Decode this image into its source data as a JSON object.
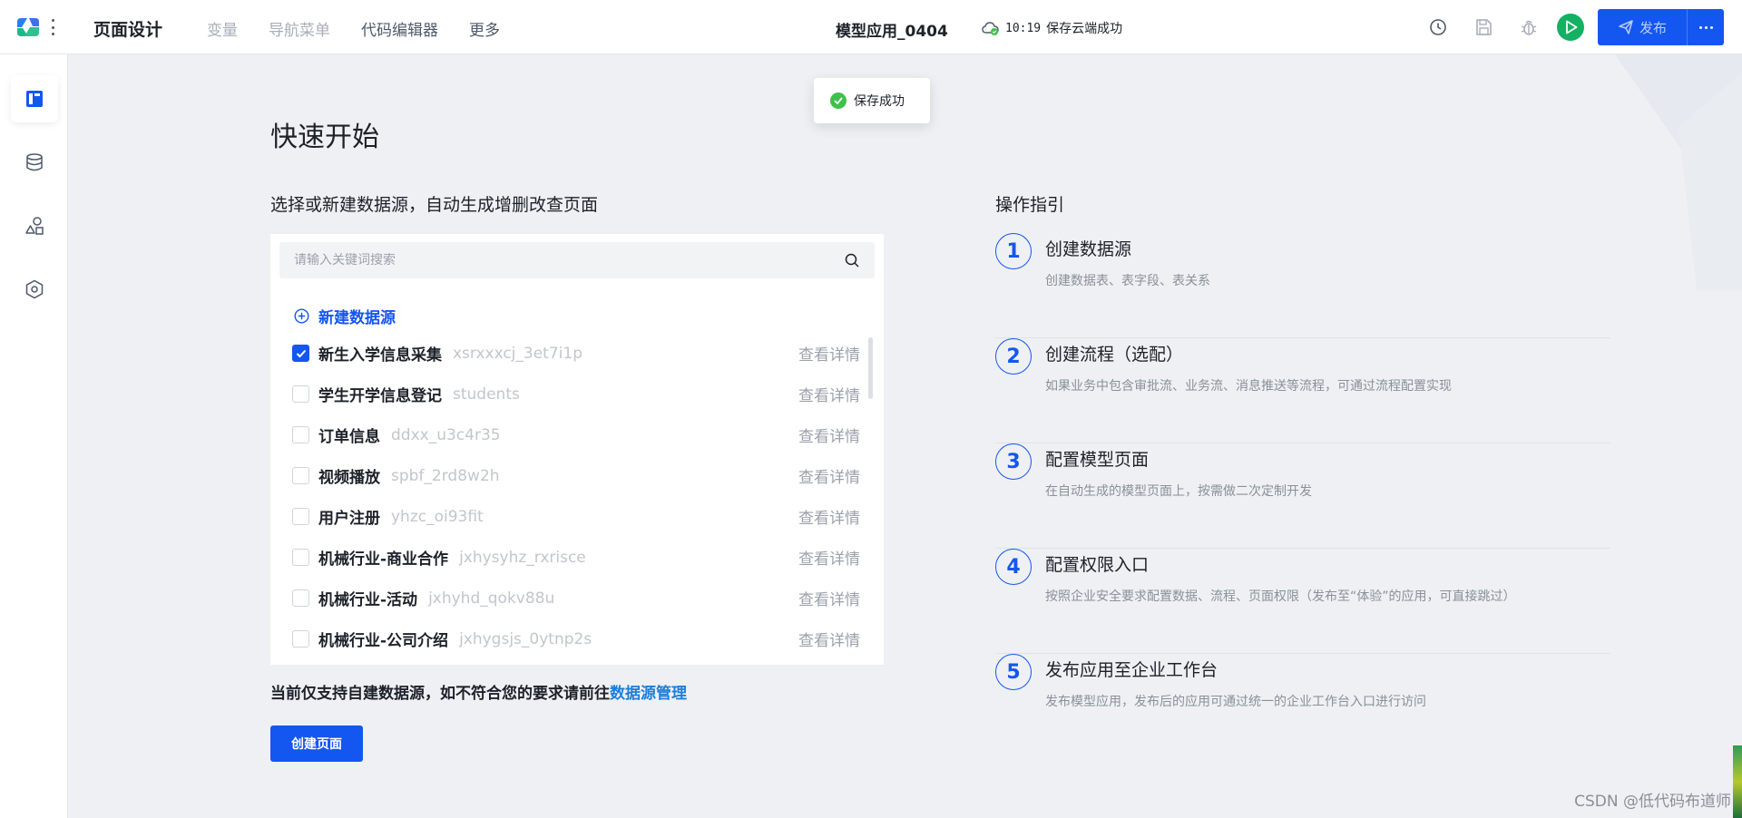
{
  "header": {
    "title": "页面设计",
    "menu": [
      {
        "label": "变量",
        "state": "disabled"
      },
      {
        "label": "导航菜单",
        "state": "disabled"
      },
      {
        "label": "代码编辑器",
        "state": "active"
      },
      {
        "label": "更多",
        "state": "active"
      }
    ],
    "app_name": "模型应用_0404",
    "save_time": "10:19",
    "save_text": "保存云端成功",
    "publish_label": "发布",
    "icons": [
      "history-icon",
      "save-icon",
      "debug-icon",
      "run-icon"
    ]
  },
  "sidebar": {
    "items": [
      "page-design-icon",
      "database-icon",
      "components-icon",
      "settings-icon"
    ],
    "help_icon": "help-icon"
  },
  "toast": {
    "text": "保存成功"
  },
  "quick_start": {
    "title": "快速开始",
    "subtitle": "选择或新建数据源，自动生成增删改查页面",
    "search_placeholder": "请输入关键词搜索",
    "new_datasource": "新建数据源",
    "datasources": [
      {
        "name": "新生入学信息采集",
        "code": "xsrxxxcj_3et7i1p",
        "detail": "查看详情",
        "checked": true
      },
      {
        "name": "学生开学信息登记",
        "code": "students",
        "detail": "查看详情",
        "checked": false
      },
      {
        "name": "订单信息",
        "code": "ddxx_u3c4r35",
        "detail": "查看详情",
        "checked": false
      },
      {
        "name": "视频播放",
        "code": "spbf_2rd8w2h",
        "detail": "查看详情",
        "checked": false
      },
      {
        "name": "用户注册",
        "code": "yhzc_oi93fit",
        "detail": "查看详情",
        "checked": false
      },
      {
        "name": "机械行业-商业合作",
        "code": "jxhysyhz_rxrisce",
        "detail": "查看详情",
        "checked": false
      },
      {
        "name": "机械行业-活动",
        "code": "jxhyhd_qokv88u",
        "detail": "查看详情",
        "checked": false
      },
      {
        "name": "机械行业-公司介绍",
        "code": "jxhygsjs_0ytnp2s",
        "detail": "查看详情",
        "checked": false
      }
    ],
    "notice_text": "当前仅支持自建数据源，如不符合您的要求请前往",
    "notice_link": "数据源管理",
    "create_button": "创建页面"
  },
  "guide": {
    "title": "操作指引",
    "steps": [
      {
        "num": "1",
        "title": "创建数据源",
        "desc": "创建数据表、表字段、表关系"
      },
      {
        "num": "2",
        "title": "创建流程（选配）",
        "desc": "如果业务中包含审批流、业务流、消息推送等流程，可通过流程配置实现"
      },
      {
        "num": "3",
        "title": "配置模型页面",
        "desc": "在自动生成的模型页面上，按需做二次定制开发"
      },
      {
        "num": "4",
        "title": "配置权限入口",
        "desc": "按照企业安全要求配置数据、流程、页面权限（发布至“体验”的应用，可直接跳过）"
      },
      {
        "num": "5",
        "title": "发布应用至企业工作台",
        "desc": "发布模型应用，发布后的应用可通过统一的企业工作台入口进行访问"
      }
    ]
  },
  "watermark": "CSDN @低代码布道师",
  "colors": {
    "primary": "#1456f0",
    "success": "#3ec14b",
    "run": "#14b063",
    "link": "#1d7ed8"
  }
}
